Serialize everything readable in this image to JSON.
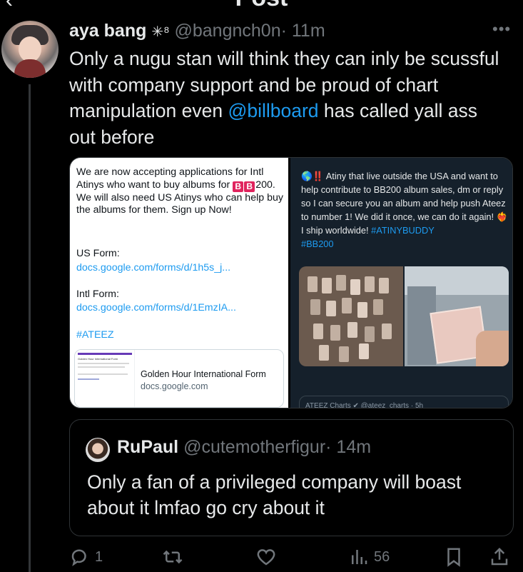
{
  "header": {
    "title": "Post",
    "back_icon": "back-arrow-icon"
  },
  "post": {
    "name": "aya bang",
    "badge": "✳⁸",
    "handle": "@bangnch0n",
    "time": "· 11m",
    "more_icon": "more-icon",
    "text_before": "Only a nugu stan will think they can inly be scussful with company support and be proud of chart manipulation even ",
    "mention": "@billboard",
    "text_after": " has called yall ass out before"
  },
  "media": {
    "left": {
      "line_1": "We are now accepting applications for Intl Atinys who want to buy albums for ",
      "bb_1": "B",
      "bb_2": "B",
      "line_2": "200.  We will also need US Atinys who can help buy the albums for them.  Sign up Now!",
      "us_label": "US Form:",
      "us_link": "docs.google.com/forms/d/1h5s_j...",
      "intl_label": "Intl Form:",
      "intl_link": "docs.google.com/forms/d/1EmzIA...",
      "hashtag": "#ATEEZ",
      "link_card": {
        "thumb_title": "Golden Hour International Form",
        "title": "Golden Hour International Form",
        "host": "docs.google.com"
      }
    },
    "right": {
      "emoji": "🌎‼️",
      "text": " Atiny that live outside the USA and want to help contribute to BB200 album sales, dm or reply so I can secure you an album and help push Ateez to number 1! We did it once, we can do it again! ❤️‍🔥 I ship worldwide! ",
      "tag_1": "#ATINYBUDDY",
      "tag_2": "#BB200",
      "quoted_line": "ATEEZ Charts ✔ @ateez_charts · 5h"
    }
  },
  "quote": {
    "name": "RuPaul",
    "handle": "@cutemotherfigur",
    "time": "· 14m",
    "text": "Only a fan of a privileged company will boast about it lmfao go cry about it"
  },
  "actions": {
    "reply_count": "1",
    "repost_count": "",
    "like_count": "",
    "views_count": "56",
    "icons": [
      "reply-icon",
      "repost-icon",
      "like-icon",
      "views-icon",
      "bookmark-icon",
      "share-icon"
    ]
  },
  "colors": {
    "background": "#000000",
    "text": "#e7e9ea",
    "muted": "#71767b",
    "link": "#1d9bf0",
    "border": "#2f3336"
  }
}
